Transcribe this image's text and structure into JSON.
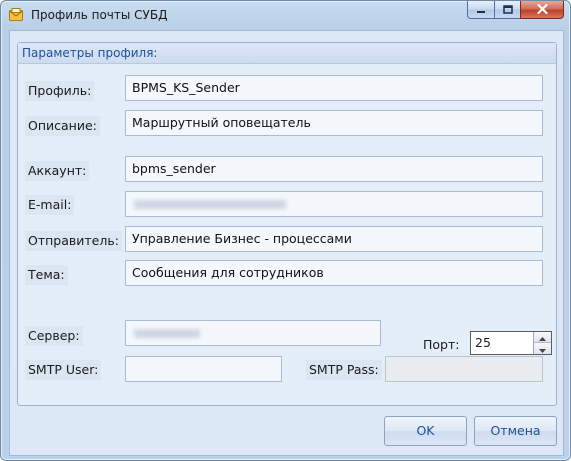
{
  "window": {
    "title": "Профиль почты СУБД",
    "buttons": {
      "minimize": "minimize-icon",
      "maximize": "maximize-icon",
      "close": "close-icon"
    }
  },
  "group": {
    "title": "Параметры профиля:"
  },
  "form": {
    "profile": {
      "label": "Профиль:",
      "value": "BPMS_KS_Sender"
    },
    "description": {
      "label": "Описание:",
      "value": "Маршрутный оповещатель"
    },
    "account": {
      "label": "Аккаунт:",
      "value": "bpms_sender"
    },
    "email": {
      "label": "E-mail:",
      "value": ""
    },
    "sender": {
      "label": "Отправитель:",
      "value": "Управление Бизнес - процессами"
    },
    "subject": {
      "label": "Тема:",
      "value": "Сообщения для сотрудников"
    },
    "server": {
      "label": "Сервер:",
      "value": ""
    },
    "port": {
      "label": "Порт:",
      "value": "25"
    },
    "smtp_user": {
      "label": "SMTP User:",
      "value": ""
    },
    "smtp_pass": {
      "label": "SMTP Pass:",
      "value": ""
    }
  },
  "actions": {
    "ok": "OK",
    "cancel": "Отмена"
  },
  "colors": {
    "accent": "#1f4e9c",
    "window_frame": "#b8cfe8",
    "close_button": "#c0402c"
  }
}
